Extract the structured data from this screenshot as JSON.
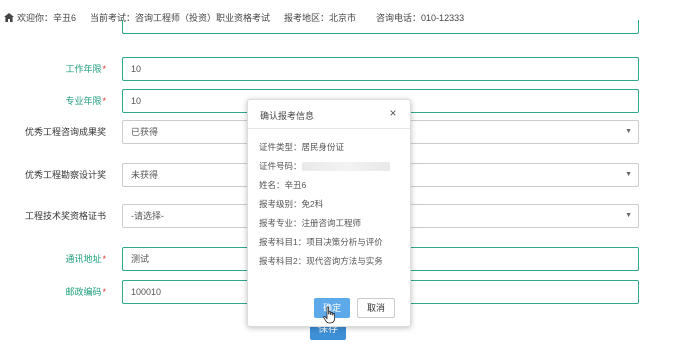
{
  "topbar": {
    "icon": "home-icon",
    "welcome": "欢迎你：辛丑6",
    "exam": "当前考试：咨询工程师（投资）职业资格考试",
    "region": "报考地区：北京市",
    "phone": "咨询电话：010-12333"
  },
  "form": {
    "rows": [
      {
        "label": "工作年限",
        "required": true,
        "value": "10",
        "type": "input"
      },
      {
        "label": "专业年限",
        "required": true,
        "value": "10",
        "type": "input"
      },
      {
        "label": "优秀工程咨询成果奖",
        "required": false,
        "value": "已获得",
        "type": "select"
      },
      {
        "label": "优秀工程勘察设计奖",
        "required": false,
        "value": "未获得",
        "type": "select"
      },
      {
        "label": "工程技术奖资格证书",
        "required": false,
        "value": "-请选择-",
        "type": "select"
      },
      {
        "label": "通讯地址",
        "required": true,
        "value": "测试",
        "type": "input"
      },
      {
        "label": "邮政编码",
        "required": true,
        "value": "100010",
        "type": "input"
      }
    ],
    "required_mark": "*",
    "select_arrow": "▼",
    "save_label": "保存"
  },
  "modal": {
    "title": "确认报考信息",
    "close": "×",
    "lines": [
      {
        "key": "cert_type",
        "text": "证件类型：居民身份证"
      },
      {
        "key": "cert_no",
        "text": "证件号码："
      },
      {
        "key": "name",
        "text": "姓名：辛丑6"
      },
      {
        "key": "level",
        "text": "报考级别：免2科"
      },
      {
        "key": "major",
        "text": "报考专业：注册咨询工程师"
      },
      {
        "key": "subject1",
        "text": "报考科目1：项目决策分析与评价"
      },
      {
        "key": "subject2",
        "text": "报考科目2：现代咨询方法与实务"
      }
    ],
    "confirm_label": "确定",
    "cancel_label": "取消"
  },
  "colors": {
    "accent_teal": "#1e9e7c",
    "required_red": "#e0322b",
    "primary_blue": "#3d8fd6"
  }
}
